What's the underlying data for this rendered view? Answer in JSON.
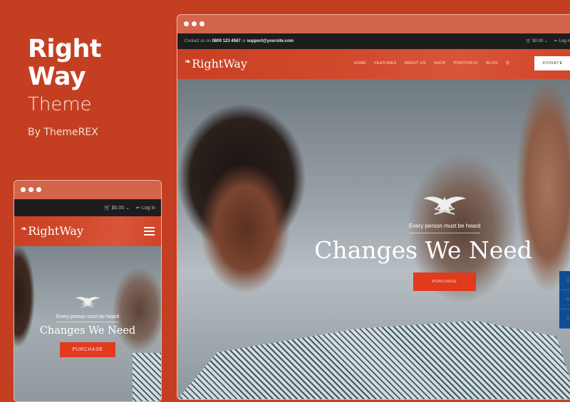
{
  "promo": {
    "title_line1": "Right",
    "title_line2": "Way",
    "subtitle": "Theme",
    "author": "By ThemeREX"
  },
  "brand": {
    "logo_text": "RightWay",
    "accent_color": "#c43f22",
    "button_color": "#e13a1d",
    "side_tool_color": "#0e4d93"
  },
  "desktop": {
    "topbar": {
      "contact_prefix": "Contact us on",
      "phone": "0800 123 4567",
      "or": "or",
      "email": "support@yoursite.com",
      "cart": "$0.00",
      "login": "Log in"
    },
    "nav": [
      "HOME",
      "FEATURES",
      "ABOUT US",
      "SHOP",
      "PORTFOLIO",
      "BLOG"
    ],
    "donate_label": "DONATE",
    "hero": {
      "tagline": "Every person must be heard",
      "headline": "Changes We Need",
      "button": "PURCHASE"
    },
    "side_tools": [
      "tool-1",
      "tool-2",
      "tool-3"
    ]
  },
  "mobile": {
    "topbar": {
      "cart": "$0.00",
      "login": "Log in"
    },
    "hero": {
      "tagline": "Every person must be heard",
      "headline": "Changes We Need",
      "button": "PURCHASE"
    }
  }
}
